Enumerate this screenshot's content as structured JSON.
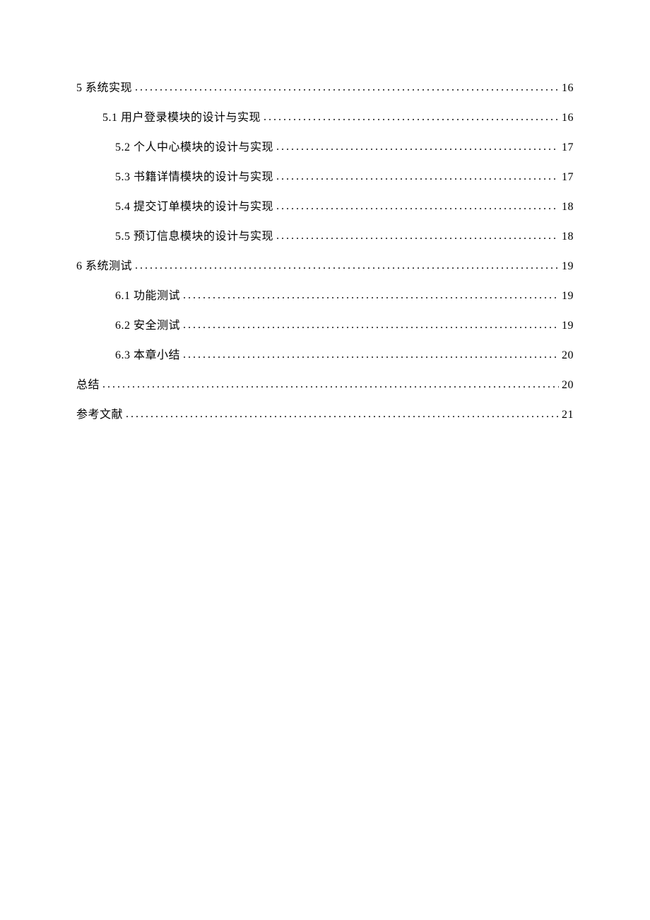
{
  "toc": [
    {
      "level": 0,
      "label": "5 系统实现",
      "page": "16"
    },
    {
      "level": 1,
      "label": "5.1 用户登录模块的设计与实现",
      "page": "16"
    },
    {
      "level": 2,
      "label": "5.2 个人中心模块的设计与实现",
      "page": "17"
    },
    {
      "level": 2,
      "label": "5.3 书籍详情模块的设计与实现",
      "page": "17"
    },
    {
      "level": 2,
      "label": "5.4 提交订单模块的设计与实现",
      "page": "18"
    },
    {
      "level": 2,
      "label": "5.5 预订信息模块的设计与实现",
      "page": "18"
    },
    {
      "level": 0,
      "label": "6 系统测试",
      "page": "19"
    },
    {
      "level": 2,
      "label": "6.1 功能测试",
      "page": "19"
    },
    {
      "level": 2,
      "label": "6.2 安全测试",
      "page": "19"
    },
    {
      "level": 2,
      "label": "6.3 本章小结",
      "page": "20"
    },
    {
      "level": 0,
      "label": "总结",
      "page": "20"
    },
    {
      "level": 0,
      "label": "参考文献",
      "page": "21"
    }
  ]
}
